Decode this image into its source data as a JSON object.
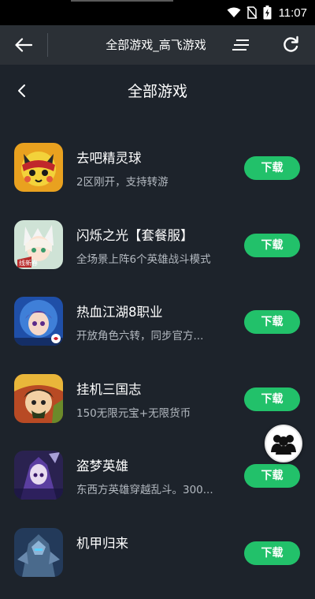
{
  "status_bar": {
    "time": "11:07"
  },
  "browser_bar": {
    "title": "全部游戏_高飞游戏"
  },
  "page": {
    "title": "全部游戏"
  },
  "games": [
    {
      "name": "去吧精灵球",
      "desc": "2区刚开，支持转游",
      "button": "下载"
    },
    {
      "name": "闪烁之光【套餐服】",
      "desc": "全场景上阵6个英雄战斗模式",
      "button": "下载"
    },
    {
      "name": "热血江湖8职业",
      "desc": "开放角色六转，同步官方...",
      "button": "下载"
    },
    {
      "name": "挂机三国志",
      "desc": "150无限元宝+无限货币",
      "button": "下载"
    },
    {
      "name": "盗梦英雄",
      "desc": "东西方英雄穿越乱斗。300...",
      "button": "下载"
    },
    {
      "name": "机甲归来",
      "desc": "",
      "button": "下载"
    }
  ],
  "icon_badge_text": "线新春",
  "colors": {
    "background": "#1d232b",
    "toolbar": "#2b3036",
    "download_button": "#22c16a",
    "secondary_text": "#b3b9c0"
  }
}
